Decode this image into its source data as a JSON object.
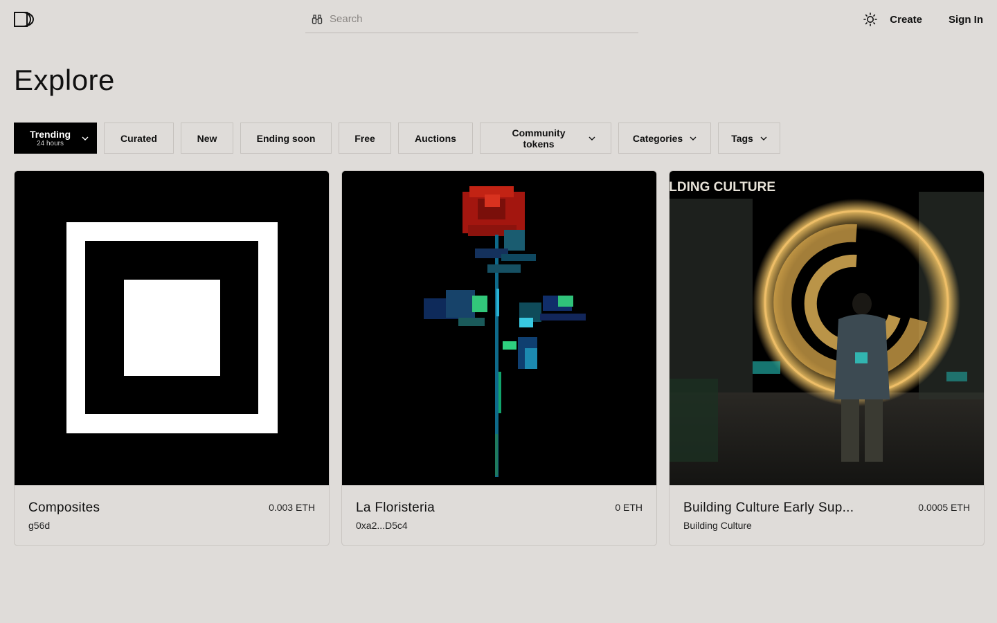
{
  "header": {
    "search_placeholder": "Search",
    "create_label": "Create",
    "signin_label": "Sign In"
  },
  "page": {
    "title": "Explore"
  },
  "filters": {
    "trending_label": "Trending",
    "trending_period": "24 hours",
    "curated_label": "Curated",
    "new_label": "New",
    "ending_soon_label": "Ending soon",
    "free_label": "Free",
    "auctions_label": "Auctions",
    "community_tokens_label": "Community tokens",
    "categories_label": "Categories",
    "tags_label": "Tags"
  },
  "cards": [
    {
      "name": "Composites",
      "creator": "g56d",
      "price": "0.003 ETH"
    },
    {
      "name": "La Floristeria",
      "creator": "0xa2...D5c4",
      "price": "0 ETH"
    },
    {
      "name": "Building Culture Early Sup...",
      "creator": "Building Culture",
      "price": "0.0005 ETH",
      "art_text": "ILDING CULTURE"
    }
  ],
  "colors": {
    "background": "#dfdcd9",
    "accent": "#000000",
    "text": "#111111"
  }
}
